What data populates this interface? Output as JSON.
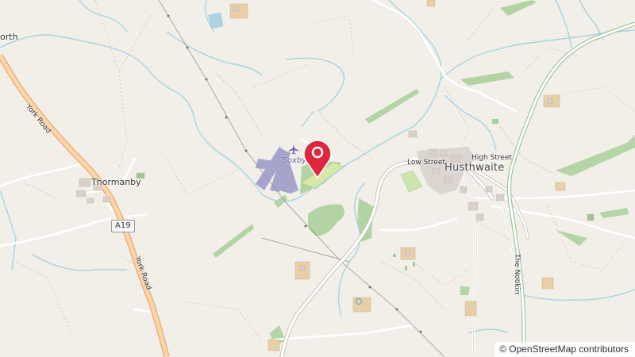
{
  "map": {
    "places": {
      "north_partial": "orth",
      "thormanby": "Thormanby",
      "husthwaite": "Husthwaite",
      "boxby": "Boxby"
    },
    "roads": {
      "york_road_upper": "York Road",
      "york_road_lower": "York Road",
      "a19_shield": "A19",
      "low_street": "Low Street",
      "high_street": "High Street",
      "the_nookin": "The Nookin"
    },
    "attribution": {
      "symbol": "©",
      "text": "OpenStreetMap contributors"
    },
    "marker": {
      "color": "#e0263e",
      "icon": "map-pin-icon"
    },
    "colors": {
      "land": "#f2efe9",
      "water": "#aad3df",
      "woodland": "#add19e",
      "primary_road": "#fcd6a4",
      "primary_road_casing": "#e8a87c",
      "building": "#d9d0c9",
      "aerodrome": "#9a98c8"
    }
  }
}
